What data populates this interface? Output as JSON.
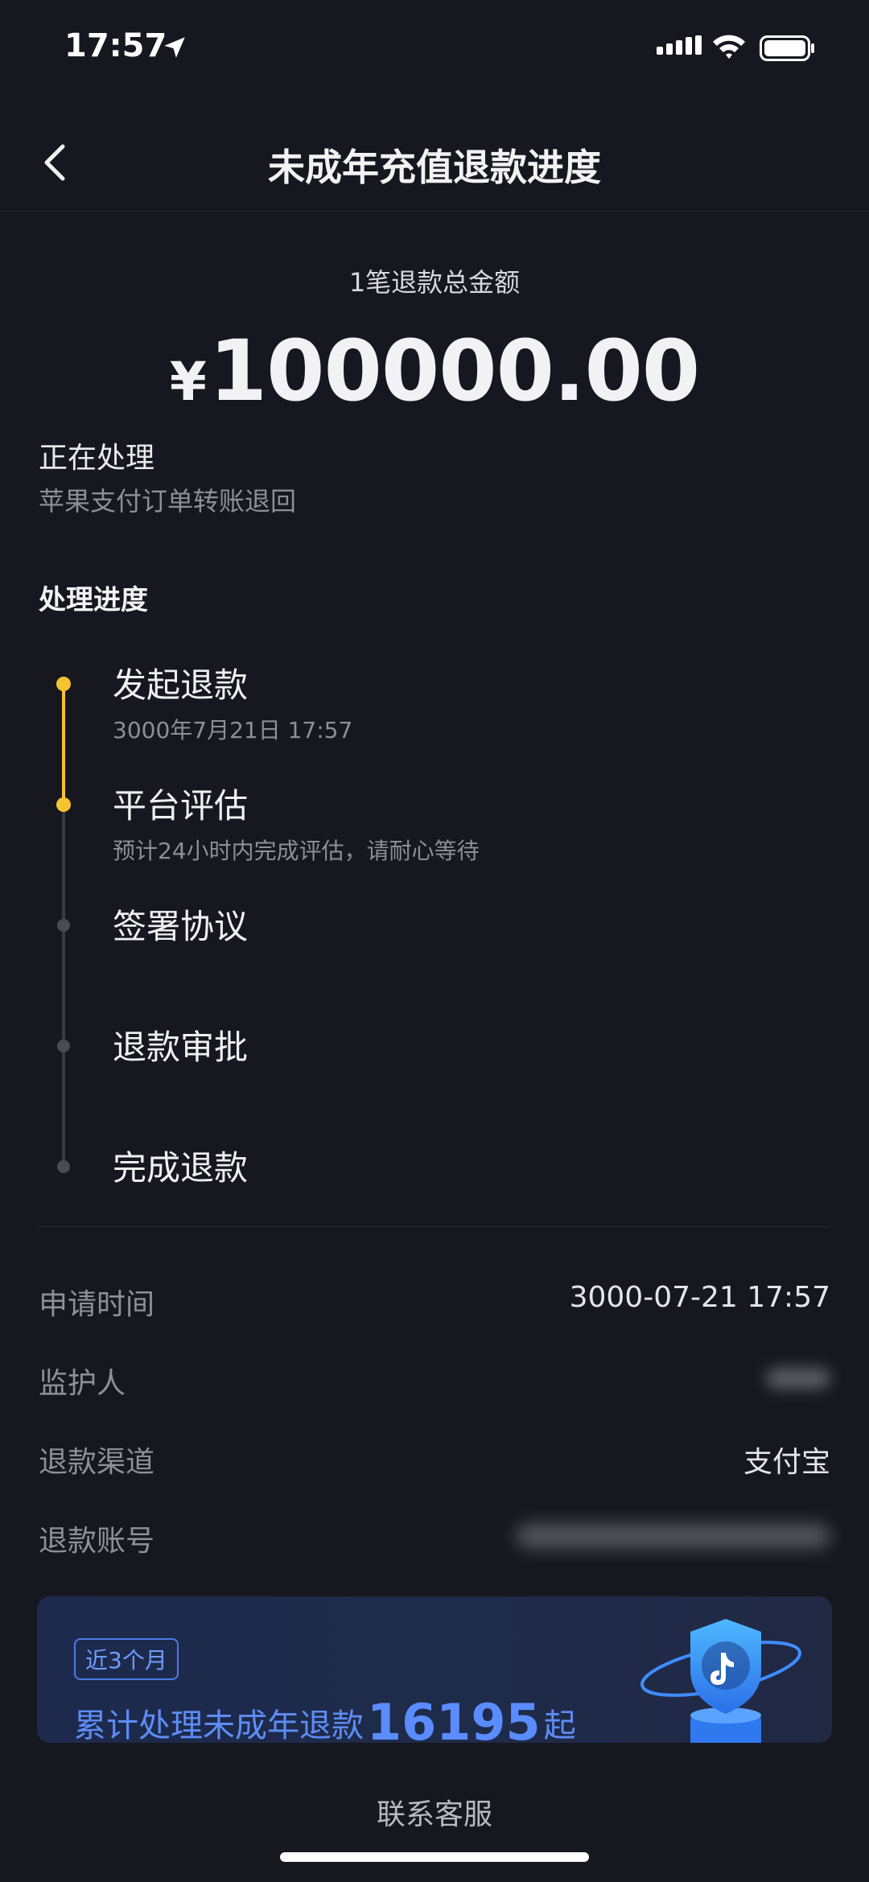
{
  "status_bar": {
    "time": "17:57"
  },
  "nav": {
    "title": "未成年充值退款进度"
  },
  "summary": {
    "total_label": "1笔退款总金额",
    "currency": "¥",
    "amount": "100000.00",
    "status": "正在处理",
    "status_detail": "苹果支付订单转账退回"
  },
  "progress": {
    "title": "处理进度",
    "steps": [
      {
        "label": "发起退款",
        "sub": "3000年7月21日 17:57",
        "state": "done"
      },
      {
        "label": "平台评估",
        "sub": "预计24小时内完成评估，请耐心等待",
        "state": "current"
      },
      {
        "label": "签署协议",
        "sub": "",
        "state": "pending"
      },
      {
        "label": "退款审批",
        "sub": "",
        "state": "pending"
      },
      {
        "label": "完成退款",
        "sub": "",
        "state": "pending"
      }
    ]
  },
  "details": {
    "apply_time_label": "申请时间",
    "apply_time_value": "3000-07-21 17:57",
    "guardian_label": "监护人",
    "channel_label": "退款渠道",
    "channel_value": "支付宝",
    "account_label": "退款账号"
  },
  "banner": {
    "tag": "近3个月",
    "text_prefix": "累计处理未成年退款",
    "count": "16195",
    "text_suffix": "起",
    "icon": "shield-douyin-icon"
  },
  "footer": {
    "contact_label": "联系客服"
  },
  "colors": {
    "accent": "#f5c331",
    "banner_blue": "#5a8cff",
    "background": "#17171f"
  }
}
